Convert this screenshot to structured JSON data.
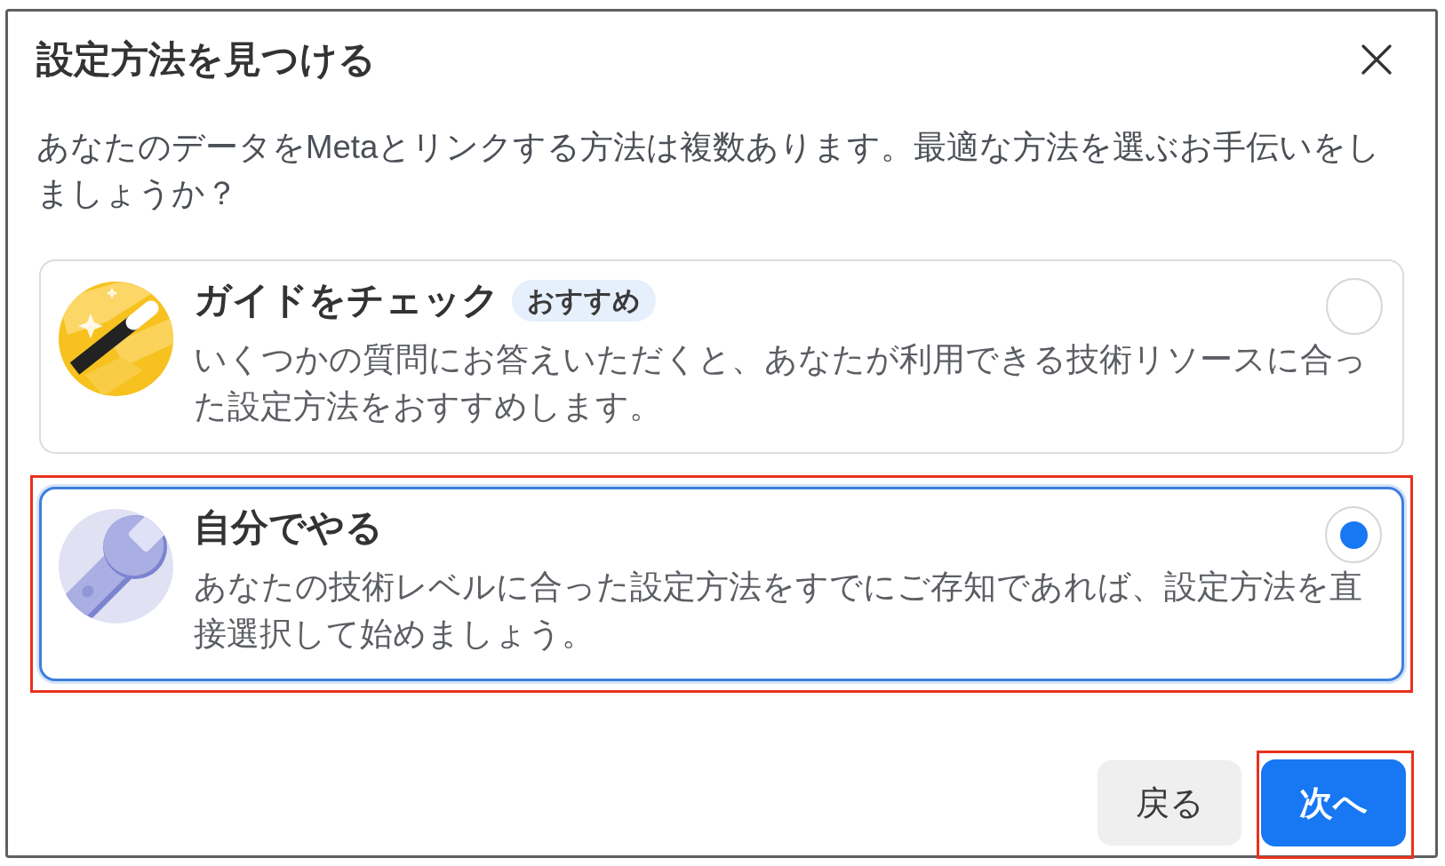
{
  "dialog": {
    "title": "設定方法を見つける",
    "description": "あなたのデータをMetaとリンクする方法は複数あります。最適な方法を選ぶお手伝いをしましょうか？"
  },
  "options": [
    {
      "kind": "guide",
      "title": "ガイドをチェック",
      "badge": "おすすめ",
      "description": "いくつかの質問にお答えいただくと、あなたが利用できる技術リソースに合った設定方法をおすすめします。",
      "selected": false,
      "highlighted": false
    },
    {
      "kind": "manual",
      "title": "自分でやる",
      "description": "あなたの技術レベルに合った設定方法をすでにご存知であれば、設定方法を直接選択して始めましょう。",
      "selected": true,
      "highlighted": true
    }
  ],
  "buttons": [
    {
      "kind": "secondary",
      "label": "戻る",
      "highlighted": false
    },
    {
      "kind": "primary",
      "label": "次へ",
      "highlighted": true
    }
  ]
}
